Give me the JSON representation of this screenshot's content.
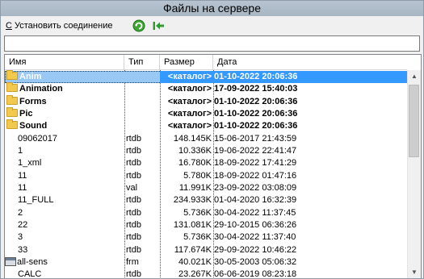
{
  "window": {
    "title": "Файлы на сервере"
  },
  "toolbar": {
    "connect_hotkey": "С",
    "connect_rest": " Установить соединение",
    "refresh_icon": "refresh-icon",
    "back_icon": "back-to-start-icon"
  },
  "path": {
    "value": ""
  },
  "columns": {
    "name": "Имя",
    "type": "Тип",
    "size": "Размер",
    "date": "Дата"
  },
  "rows": [
    {
      "name": "Anim",
      "type": "",
      "size": "<каталог>",
      "date": "01-10-2022 20:06:36",
      "kind": "dir",
      "selected": true
    },
    {
      "name": "Animation",
      "type": "",
      "size": "<каталог>",
      "date": "17-09-2022 15:40:03",
      "kind": "dir"
    },
    {
      "name": "Forms",
      "type": "",
      "size": "<каталог>",
      "date": "01-10-2022 20:06:36",
      "kind": "dir"
    },
    {
      "name": "Pic",
      "type": "",
      "size": "<каталог>",
      "date": "01-10-2022 20:06:36",
      "kind": "dir"
    },
    {
      "name": "Sound",
      "type": "",
      "size": "<каталог>",
      "date": "01-10-2022 20:06:36",
      "kind": "dir"
    },
    {
      "name": "09062017",
      "type": "rtdb",
      "size": "148.145K",
      "date": "15-06-2017 21:43:59",
      "kind": "file"
    },
    {
      "name": "1",
      "type": "rtdb",
      "size": "10.336K",
      "date": "19-06-2022 22:41:47",
      "kind": "file"
    },
    {
      "name": "1_xml",
      "type": "rtdb",
      "size": "16.780K",
      "date": "18-09-2022 17:41:29",
      "kind": "file"
    },
    {
      "name": "11",
      "type": "rtdb",
      "size": "5.780K",
      "date": "18-09-2022 01:47:16",
      "kind": "file"
    },
    {
      "name": "11",
      "type": "val",
      "size": "11.991K",
      "date": "23-09-2022 03:08:09",
      "kind": "file"
    },
    {
      "name": "11_FULL",
      "type": "rtdb",
      "size": "234.933K",
      "date": "01-04-2020 16:32:39",
      "kind": "file"
    },
    {
      "name": "2",
      "type": "rtdb",
      "size": "5.736K",
      "date": "30-04-2022 11:37:45",
      "kind": "file"
    },
    {
      "name": "22",
      "type": "rtdb",
      "size": "131.081K",
      "date": "29-10-2015 06:36:26",
      "kind": "file"
    },
    {
      "name": "3",
      "type": "rtdb",
      "size": "5.736K",
      "date": "30-04-2022 11:37:40",
      "kind": "file"
    },
    {
      "name": "33",
      "type": "rtdb",
      "size": "117.674K",
      "date": "29-09-2022 10:46:22",
      "kind": "file"
    },
    {
      "name": "all-sens",
      "type": "frm",
      "size": "40.021K",
      "date": "30-05-2003 05:06:32",
      "kind": "form"
    },
    {
      "name": "CALC",
      "type": "rtdb",
      "size": "23.267K",
      "date": "06-06-2019 08:23:18",
      "kind": "file"
    }
  ],
  "colors": {
    "selection": "#99c8f4",
    "selection_strong": "#3399ff",
    "folder": "#f2c94c",
    "titlebar": "#b7c3d0"
  }
}
